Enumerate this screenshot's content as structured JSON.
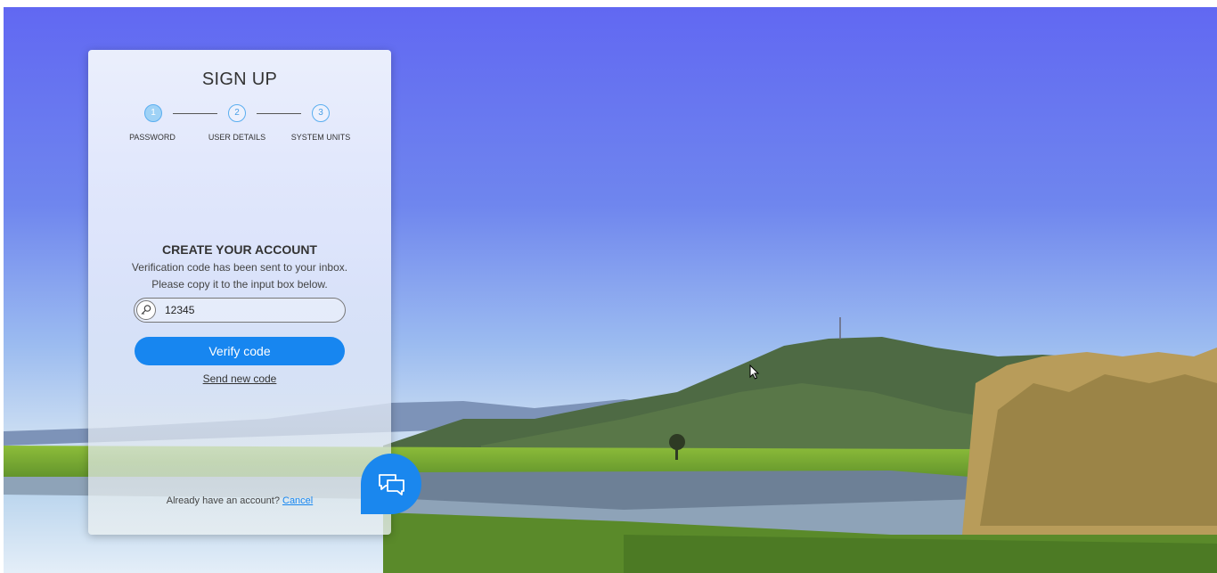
{
  "signup": {
    "title": "SIGN UP",
    "steps": [
      {
        "number": "1",
        "label": "PASSWORD",
        "state": "active"
      },
      {
        "number": "2",
        "label": "USER DETAILS",
        "state": "pending"
      },
      {
        "number": "3",
        "label": "SYSTEM UNITS",
        "state": "pending"
      }
    ],
    "heading": "CREATE YOUR ACCOUNT",
    "message_line1": "Verification code has been sent to your inbox.",
    "message_line2": "Please copy it to the input box below.",
    "code_field": {
      "value": "12345",
      "icon": "key-icon"
    },
    "verify_button": "Verify code",
    "send_new_code_link": "Send new code",
    "footer": {
      "prompt": "Already have an account?",
      "cancel_link": "Cancel"
    }
  },
  "chat_widget": {
    "icon": "chat-bubbles-icon"
  },
  "colors": {
    "accent": "#1786f0",
    "step_ring": "#5aaef0",
    "sky": "#6b72f0"
  }
}
